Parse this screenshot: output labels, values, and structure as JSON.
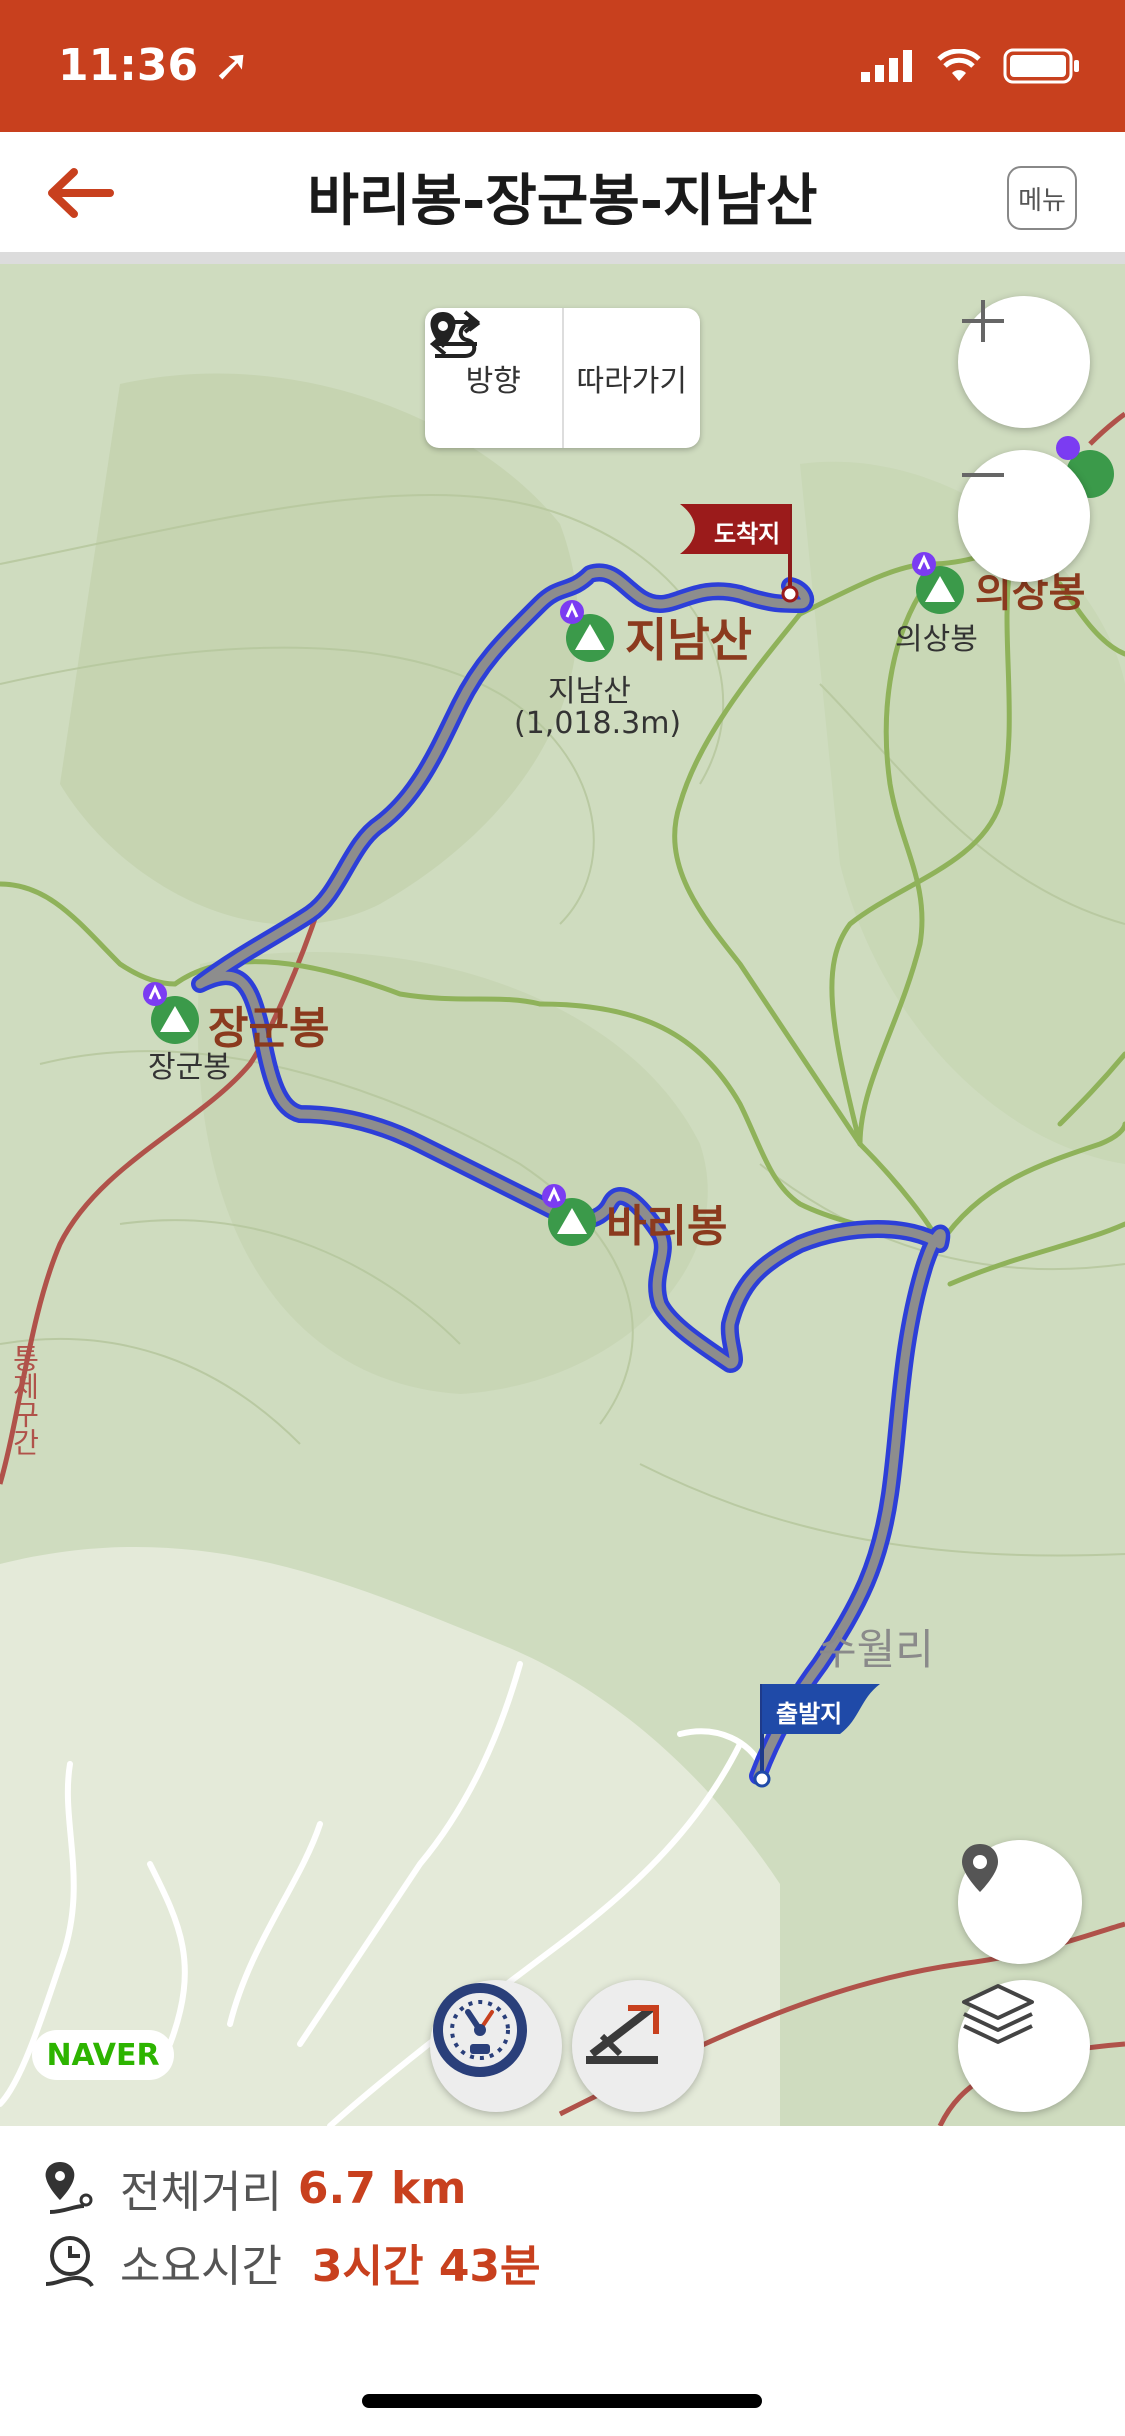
{
  "status": {
    "time": "11:36"
  },
  "header": {
    "title": "바리봉-장군봉-지남산",
    "menu_label": "메뉴"
  },
  "map": {
    "controls": {
      "direction_label": "방향",
      "follow_label": "따라가기"
    },
    "labels": {
      "jangunbong": "장군봉",
      "jangunbong_small": "장군봉",
      "baribong": "바리봉",
      "jinamsan": "지남산",
      "jinamsan_small": "지남산",
      "jinamsan_elev": "(1,018.3m)",
      "uisangbong": "의상봉",
      "uisangbong_small": "의상봉",
      "suwolri": "수월리",
      "road": "통제구간",
      "arrival": "도착지",
      "departure": "출발지"
    },
    "naver_logo": "NAVER"
  },
  "summary": {
    "distance_label": "전체거리",
    "distance_value": "6.7 km",
    "time_label": "소요시간",
    "time_value": "3시간 43분"
  },
  "colors": {
    "accent": "#c8401e",
    "route": "#2d3fd8",
    "trail": "#8fb25a"
  }
}
